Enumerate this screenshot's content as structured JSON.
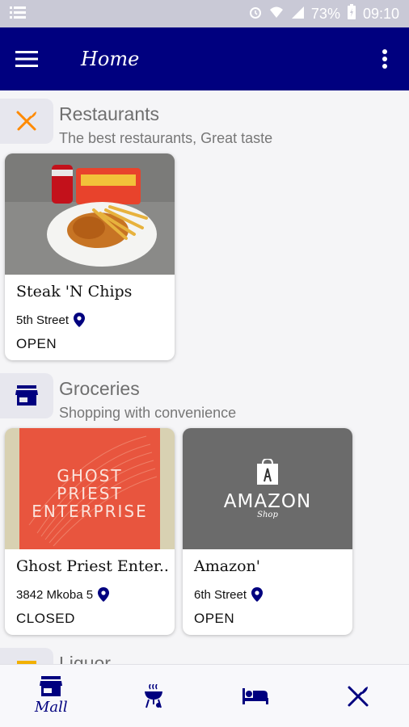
{
  "status_bar": {
    "battery": "73%",
    "time": "09:10"
  },
  "app_bar": {
    "title": "Home"
  },
  "sections": [
    {
      "title": "Restaurants",
      "subtitle": "The best restaurants, Great taste",
      "icon": "fork-knife-icon"
    },
    {
      "title": "Groceries",
      "subtitle": "Shopping with convenience",
      "icon": "store-icon"
    },
    {
      "title": "Liquor",
      "icon": "liquor-icon"
    }
  ],
  "restaurants": [
    {
      "name": "Steak 'N Chips",
      "address": "5th Street",
      "status": "OPEN"
    }
  ],
  "groceries": [
    {
      "name": "Ghost Priest Enter..",
      "address": "3842 Mkoba 5",
      "status": "CLOSED",
      "image_text": [
        "GHOST",
        "PRIEST",
        "ENTERPRISE"
      ]
    },
    {
      "name": "Amazon'",
      "address": "6th Street",
      "status": "OPEN",
      "image_text": [
        "AMAZON",
        "Shop"
      ]
    }
  ],
  "bottom_nav": [
    {
      "label": "Mall",
      "icon": "store-icon",
      "active": true
    },
    {
      "label": "",
      "icon": "grill-icon"
    },
    {
      "label": "",
      "icon": "bed-icon"
    },
    {
      "label": "",
      "icon": "fork-knife-icon"
    }
  ],
  "colors": {
    "primary": "#00007f",
    "accent_orange": "#ff8a00"
  }
}
